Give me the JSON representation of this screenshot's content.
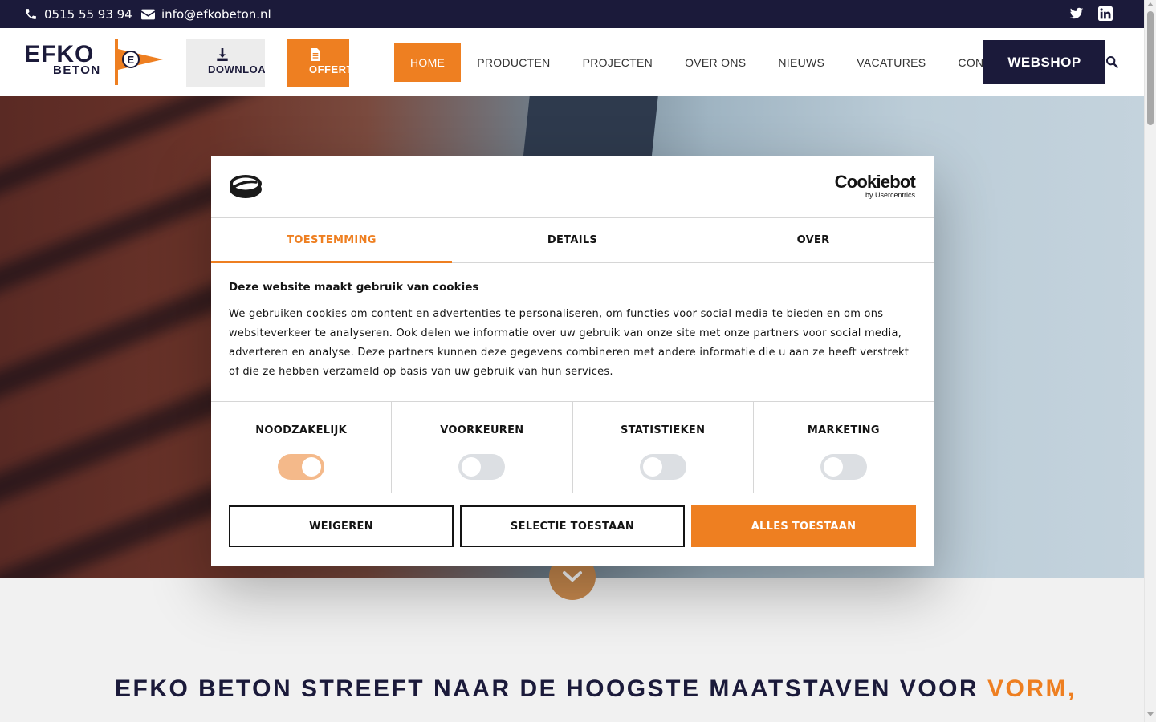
{
  "topbar": {
    "phone": "0515 55 93 94",
    "email": "info@efkobeton.nl",
    "social": [
      "twitter-icon",
      "linkedin-icon"
    ]
  },
  "header": {
    "logo_line1": "EFKO",
    "logo_line2": "BETON",
    "logo_badge": "E",
    "download_label": "DOWNLOADS",
    "offerte_label": "OFFERTE",
    "nav": [
      "HOME",
      "PRODUCTEN",
      "PROJECTEN",
      "OVER ONS",
      "NIEUWS",
      "VACATURES",
      "CONTACT"
    ],
    "active_nav": "HOME",
    "webshop_label": "WEBSHOP"
  },
  "cookie_dialog": {
    "brand": "Cookiebot",
    "brand_sub": "by Usercentrics",
    "tabs": [
      "TOESTEMMING",
      "DETAILS",
      "OVER"
    ],
    "active_tab": "TOESTEMMING",
    "heading": "Deze website maakt gebruik van cookies",
    "body": "We gebruiken cookies om content en advertenties te personaliseren, om functies voor social media te bieden en om ons websiteverkeer te analyseren. Ook delen we informatie over uw gebruik van onze site met onze partners voor social media, adverteren en analyse. Deze partners kunnen deze gegevens combineren met andere informatie die u aan ze heeft verstrekt of die ze hebben verzameld op basis van uw gebruik van hun services.",
    "categories": [
      {
        "label": "NOODZAKELIJK",
        "enabled": true
      },
      {
        "label": "VOORKEUREN",
        "enabled": false
      },
      {
        "label": "STATISTIEKEN",
        "enabled": false
      },
      {
        "label": "MARKETING",
        "enabled": false
      }
    ],
    "buttons": {
      "decline": "WEIGEREN",
      "selection": "SELECTIE TOESTAAN",
      "accept_all": "ALLES TOESTAAN"
    }
  },
  "section": {
    "title_main": "EFKO BETON STREEFT NAAR DE HOOGSTE MAATSTAVEN VOOR",
    "title_accent": "VORM,"
  },
  "colors": {
    "navy": "#1b1a3a",
    "orange": "#ee7f21"
  }
}
